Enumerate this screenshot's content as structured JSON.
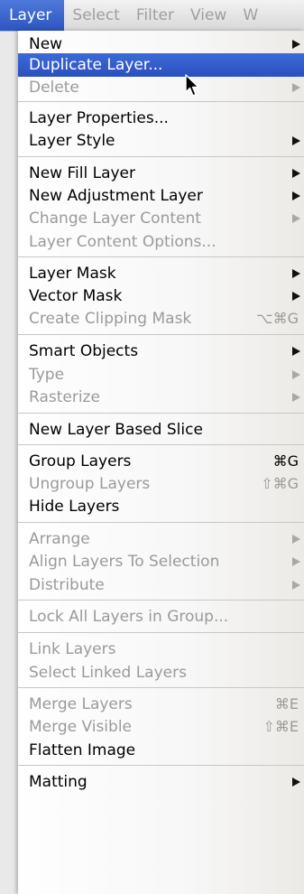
{
  "menubar": {
    "items": [
      {
        "label": "Layer",
        "active": true
      },
      {
        "label": "Select",
        "active": false
      },
      {
        "label": "Filter",
        "active": false
      },
      {
        "label": "View",
        "active": false
      },
      {
        "label": "W",
        "active": false
      }
    ]
  },
  "menu": {
    "items": [
      {
        "label": "New",
        "enabled": true,
        "submenu": true
      },
      {
        "label": "Duplicate Layer...",
        "enabled": true,
        "highlighted": true
      },
      {
        "label": "Delete",
        "enabled": false,
        "submenu": true
      },
      {
        "label": "Layer Properties...",
        "enabled": true
      },
      {
        "label": "Layer Style",
        "enabled": true,
        "submenu": true
      },
      {
        "label": "New Fill Layer",
        "enabled": true,
        "submenu": true
      },
      {
        "label": "New Adjustment Layer",
        "enabled": true,
        "submenu": true
      },
      {
        "label": "Change Layer Content",
        "enabled": false,
        "submenu": true
      },
      {
        "label": "Layer Content Options...",
        "enabled": false
      },
      {
        "label": "Layer Mask",
        "enabled": true,
        "submenu": true
      },
      {
        "label": "Vector Mask",
        "enabled": true,
        "submenu": true
      },
      {
        "label": "Create Clipping Mask",
        "enabled": false,
        "shortcut": "⌥⌘G"
      },
      {
        "label": "Smart Objects",
        "enabled": true,
        "submenu": true
      },
      {
        "label": "Type",
        "enabled": false,
        "submenu": true
      },
      {
        "label": "Rasterize",
        "enabled": false,
        "submenu": true
      },
      {
        "label": "New Layer Based Slice",
        "enabled": true
      },
      {
        "label": "Group Layers",
        "enabled": true,
        "shortcut": "⌘G"
      },
      {
        "label": "Ungroup Layers",
        "enabled": false,
        "shortcut": "⇧⌘G"
      },
      {
        "label": "Hide Layers",
        "enabled": true
      },
      {
        "label": "Arrange",
        "enabled": false,
        "submenu": true
      },
      {
        "label": "Align Layers To Selection",
        "enabled": false,
        "submenu": true
      },
      {
        "label": "Distribute",
        "enabled": false,
        "submenu": true
      },
      {
        "label": "Lock All Layers in Group...",
        "enabled": false
      },
      {
        "label": "Link Layers",
        "enabled": false
      },
      {
        "label": "Select Linked Layers",
        "enabled": false
      },
      {
        "label": "Merge Layers",
        "enabled": false,
        "shortcut": "⌘E"
      },
      {
        "label": "Merge Visible",
        "enabled": false,
        "shortcut": "⇧⌘E"
      },
      {
        "label": "Flatten Image",
        "enabled": true
      },
      {
        "label": "Matting",
        "enabled": true,
        "submenu": true
      }
    ]
  },
  "colors": {
    "highlight": "#2f58c6",
    "disabled_text": "#9a9a9a"
  }
}
